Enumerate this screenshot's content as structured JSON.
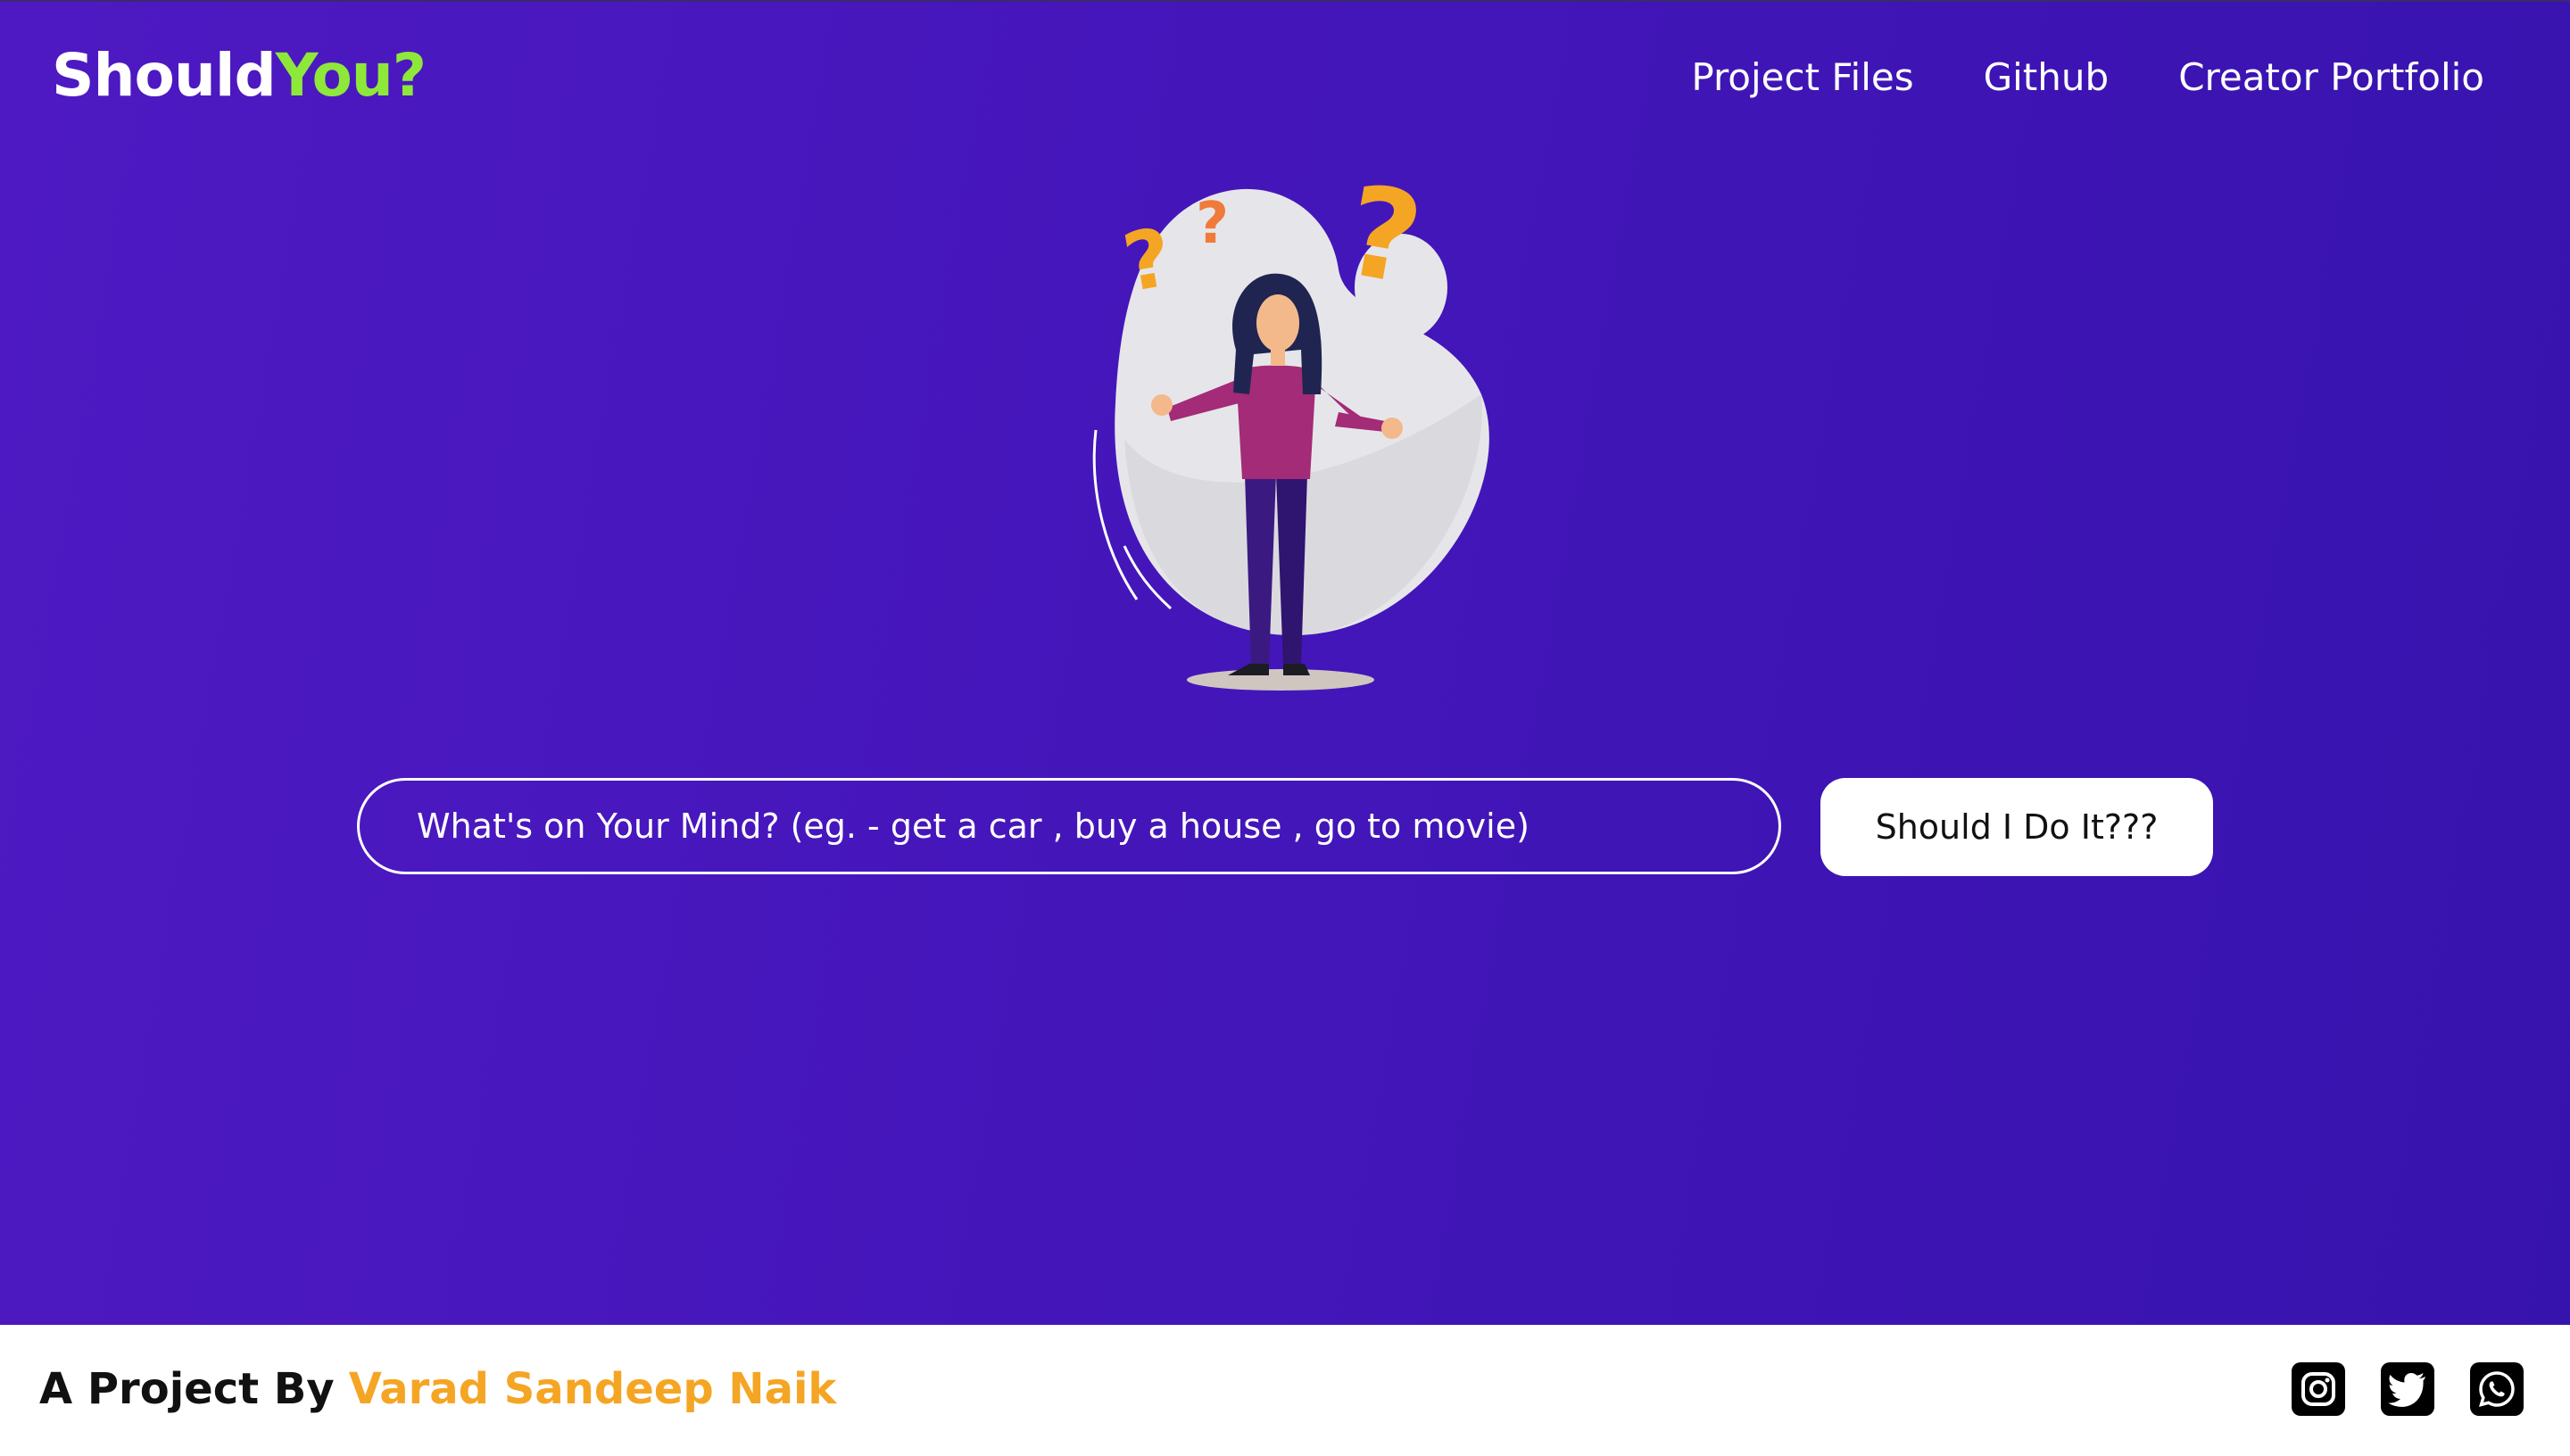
{
  "header": {
    "logo_main": "Should",
    "logo_accent": "You?",
    "nav": [
      {
        "label": "Project Files"
      },
      {
        "label": "Github"
      },
      {
        "label": "Creator Portfolio"
      }
    ]
  },
  "main": {
    "search_placeholder": "What's on Your Mind? (eg. - get a car , buy a house , go to movie)",
    "submit_label": "Should I Do It???"
  },
  "footer": {
    "credit_prefix": "A Project By",
    "credit_name": "Varad Sandeep Naik",
    "socials": [
      {
        "icon": "instagram-icon"
      },
      {
        "icon": "twitter-icon"
      },
      {
        "icon": "whatsapp-icon"
      }
    ]
  },
  "colors": {
    "hero_gradient_start": "#4e19c2",
    "hero_gradient_end": "#3713ad",
    "logo_accent": "#8ee83a",
    "credit_name": "#f5a524",
    "button_bg": "#ffffff"
  }
}
